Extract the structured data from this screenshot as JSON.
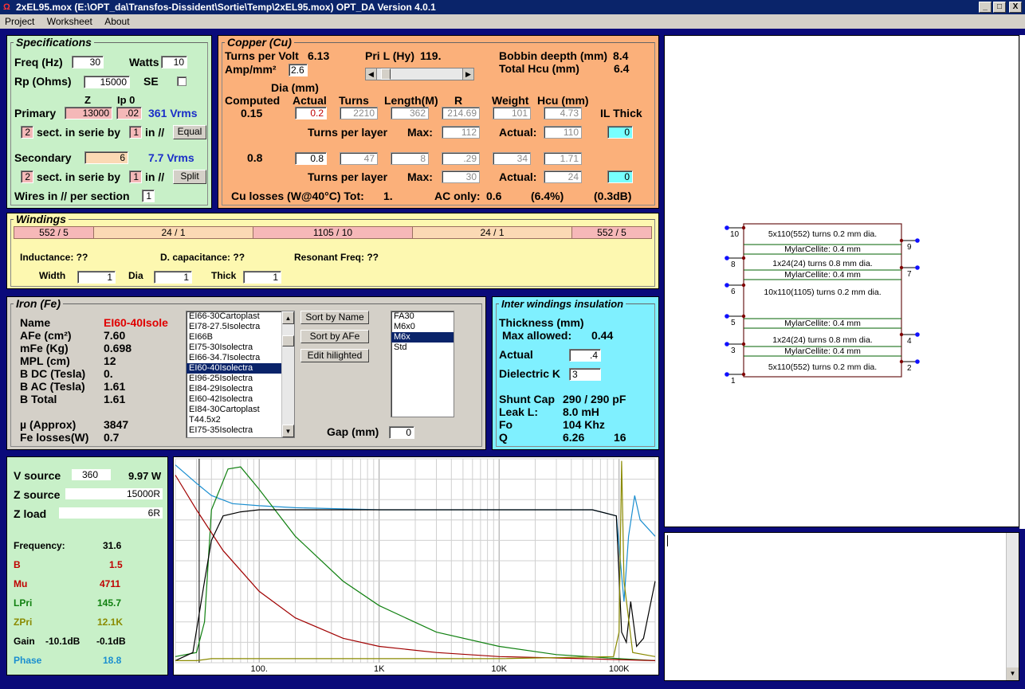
{
  "window": {
    "title": "2xEL95.mox  (E:\\OPT_da\\Transfos-Dissident\\Sortie\\Temp\\2xEL95.mox)  OPT_DA Version 4.0.1",
    "min": "_",
    "max": "□",
    "close": "X"
  },
  "menu": [
    "Project",
    "Worksheet",
    "About"
  ],
  "spec": {
    "title": "Specifications",
    "freq_l": "Freq (Hz)",
    "freq": "30",
    "watts_l": "Watts",
    "watts": "10",
    "rp_l": "Rp (Ohms)",
    "rp": "15000",
    "se_l": "SE",
    "z_l": "Z",
    "ip0_l": "Ip 0",
    "primary_l": "Primary",
    "primary_z": "13000",
    "primary_ip": ".02",
    "primary_v": "361 Vrms",
    "p_sect": "2",
    "sect_l": "sect. in serie by",
    "p_par": "1",
    "in_l": "in //",
    "equal": "Equal",
    "secondary_l": "Secondary",
    "secondary_z": "6",
    "secondary_v": "7.7 Vrms",
    "s_sect": "2",
    "s_par": "1",
    "split": "Split",
    "wires_l": "Wires in // per section",
    "wires": "1"
  },
  "copper": {
    "title": "Copper (Cu)",
    "tpv_l": "Turns per Volt",
    "tpv": "6.13",
    "amp_l": "Amp/mm²",
    "amp": "2.6",
    "pril_l": "Pri L (Hy)",
    "pril": "119.",
    "bob_l": "Bobbin deepth (mm)",
    "bob": "8.4",
    "hcu_total_l": "Total Hcu (mm)",
    "hcu_total": "6.4",
    "dia_l": "Dia (mm)",
    "computed_l": "Computed",
    "actual_l": "Actual",
    "turns_l": "Turns",
    "length_l": "Length(M)",
    "r_l": "R",
    "weight_l": "Weight",
    "hcu_l": "Hcu (mm)",
    "ilthick_l": "IL Thick",
    "r1": {
      "computed": "0.15",
      "actual": "0.2",
      "turns": "2210",
      "length": "362",
      "r": "214.69",
      "weight": "101",
      "hcu": "4.73",
      "tpl_l": "Turns per layer",
      "max_l": "Max:",
      "max": "112",
      "act_l": "Actual:",
      "act": "110",
      "il": "0"
    },
    "r2": {
      "computed": "0.8",
      "actual": "0.8",
      "turns": "47",
      "length": "8",
      "r": ".29",
      "weight": "34",
      "hcu": "1.71",
      "tpl_l": "Turns per layer",
      "max_l": "Max:",
      "max": "30",
      "act_l": "Actual:",
      "act": "24",
      "il": "0"
    },
    "losses_l": "Cu losses (W@40°C) Tot:",
    "losses_tot": "1.",
    "ac_l": "AC only:",
    "ac": "0.6",
    "pct": "(6.4%)",
    "db": "(0.3dB)"
  },
  "windings": {
    "title": "Windings",
    "cells": [
      "552 / 5",
      "24 / 1",
      "1105 / 10",
      "24 / 1",
      "552 / 5"
    ],
    "ind_l": "Inductance: ??",
    "dcap_l": "D. capacitance: ??",
    "res_l": "Resonant Freq: ??",
    "width_l": "Width",
    "width": "1",
    "dia_l": "Dia",
    "dia": "1",
    "thick_l": "Thick",
    "thick": "1"
  },
  "iron": {
    "title": "Iron (Fe)",
    "name_l": "Name",
    "name": "EI60-40Isole",
    "afe_l": "AFe (cm²)",
    "afe": "7.60",
    "mfe_l": "mFe (Kg)",
    "mfe": "0.698",
    "mpl_l": "MPL (cm)",
    "mpl": "12",
    "bdc_l": "B DC (Tesla)",
    "bdc": "0.",
    "bac_l": "B AC (Tesla)",
    "bac": "1.61",
    "btot_l": "B Total",
    "btot": "1.61",
    "mu_l": "µ (Approx)",
    "mu": "3847",
    "fel_l": "Fe losses(W)",
    "fel": "0.7",
    "cores": [
      "EI66-30Cartoplast",
      "EI78-27.5Isolectra",
      "EI66B",
      "EI75-30Isolectra",
      "EI66-34.7Isolectra",
      "EI60-40Isolectra",
      "EI96-25Isolectra",
      "EI84-29Isolectra",
      "EI60-42Isolectra",
      "EI84-30Cartoplast",
      "T44.5x2",
      "EI75-35Isolectra"
    ],
    "core_sel": 5,
    "sort_name": "Sort by Name",
    "sort_afe": "Sort by AFe",
    "edit": "Edit hilighted",
    "mats": [
      "FA30",
      "M6x0",
      "M6x",
      "Std"
    ],
    "mat_sel": 2,
    "gap_l": "Gap (mm)",
    "gap": "0"
  },
  "insul": {
    "title": "Inter windings insulation",
    "thick_l": "Thickness (mm)",
    "max_l": "Max allowed:",
    "max": "0.44",
    "actual_l": "Actual",
    "actual": ".4",
    "diel_l": "Dielectric K",
    "diel": "3",
    "shunt_l": "Shunt Cap",
    "shunt": "290 / 290 pF",
    "leak_l": "Leak L:",
    "leak": "8.0 mH",
    "fo_l": "Fo",
    "fo": "104 Khz",
    "q_l": "Q",
    "q": "6.26",
    "q2": "16"
  },
  "source": {
    "vs_l": "V source",
    "vs": "360",
    "vs_w": "9.97 W",
    "zs_l": "Z source",
    "zs": "15000R",
    "zl_l": "Z load",
    "zl": "6R",
    "freq_l": "Frequency:",
    "freq": "31.6",
    "b_l": "B",
    "b": "1.5",
    "mu_l": "Mu",
    "mu": "4711",
    "lpri_l": "LPri",
    "lpri": "145.7",
    "zpri_l": "ZPri",
    "zpri": "12.1K",
    "gain_l": "Gain",
    "gain1": "-10.1dB",
    "gain2": "-0.1dB",
    "phase_l": "Phase",
    "phase": "18.8"
  },
  "colors": {
    "red": "#a00000",
    "green": "#108010",
    "olive": "#8a8a00",
    "blue": "#1a8ed0",
    "black": "#000000"
  },
  "chart_data": {
    "type": "line",
    "x_scale": "log",
    "xlim": [
      20,
      200000
    ],
    "x_ticks": [
      "100.",
      "1K",
      "10K",
      "100K"
    ],
    "ylim": [
      0,
      100
    ],
    "grid": true,
    "series": [
      {
        "color": "#1a8ed0",
        "x": [
          20,
          30,
          40,
          60,
          100,
          200,
          1000,
          10000,
          60000,
          95000,
          110000,
          120000,
          135000,
          150000,
          200000
        ],
        "y": [
          97,
          88,
          82,
          78,
          77,
          76,
          75,
          75,
          75,
          72,
          30,
          62,
          82,
          70,
          62
        ]
      },
      {
        "color": "#108010",
        "x": [
          20,
          30,
          35,
          40,
          55,
          70,
          100,
          200,
          500,
          1000,
          3000,
          10000,
          30000,
          100000,
          200000
        ],
        "y": [
          3,
          5,
          20,
          75,
          95,
          96,
          85,
          62,
          40,
          28,
          15,
          8,
          4,
          2,
          1
        ]
      },
      {
        "color": "#a00000",
        "x": [
          20,
          30,
          50,
          100,
          200,
          500,
          1000,
          3000,
          10000,
          50000,
          200000
        ],
        "y": [
          92,
          75,
          55,
          35,
          22,
          12,
          8,
          5,
          3,
          2,
          1
        ]
      },
      {
        "color": "#000000",
        "x": [
          20,
          28,
          35,
          40,
          50,
          70,
          100,
          200,
          1000,
          10000,
          60000,
          95000,
          105000,
          115000,
          125000,
          140000,
          160000,
          200000
        ],
        "y": [
          1,
          5,
          40,
          60,
          72,
          74,
          75,
          75,
          75,
          75,
          75,
          72,
          15,
          10,
          30,
          8,
          12,
          40
        ]
      },
      {
        "color": "#8a8a00",
        "x": [
          20,
          30,
          40,
          60,
          100,
          1000,
          10000,
          90000,
          100000,
          105000,
          110000,
          130000,
          200000
        ],
        "y": [
          1,
          1,
          2,
          2,
          2,
          2,
          2,
          3,
          15,
          99,
          40,
          5,
          3
        ]
      }
    ]
  },
  "output": {
    "scrollbar": "▼"
  }
}
